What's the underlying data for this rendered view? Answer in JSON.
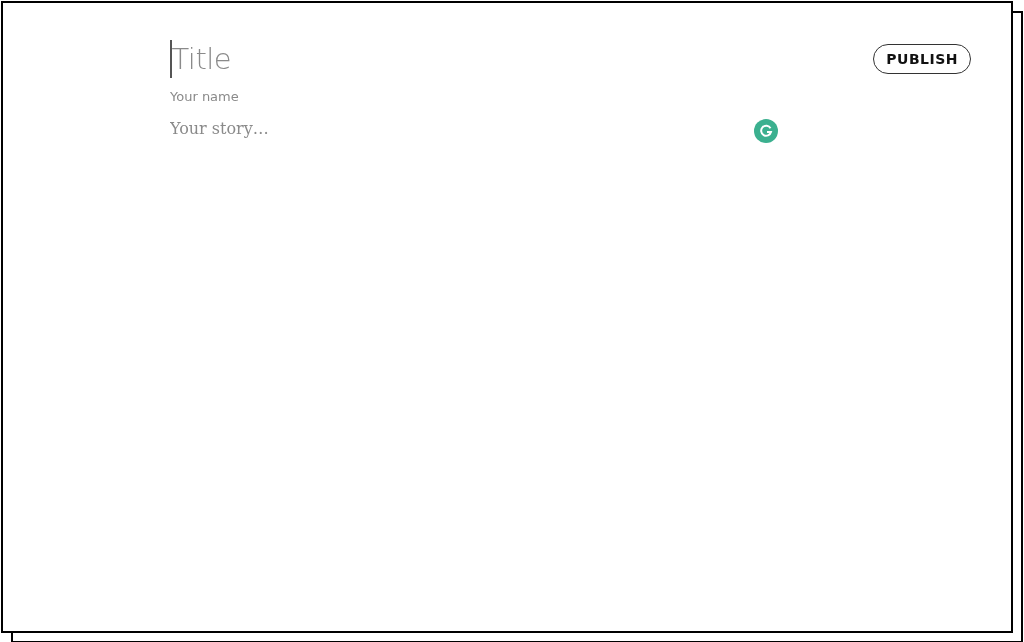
{
  "editor": {
    "title": {
      "placeholder": "Title"
    },
    "author": {
      "placeholder": "Your name"
    },
    "story": {
      "placeholder": "Your story…"
    }
  },
  "publish_button": {
    "label": "PUBLISH"
  }
}
